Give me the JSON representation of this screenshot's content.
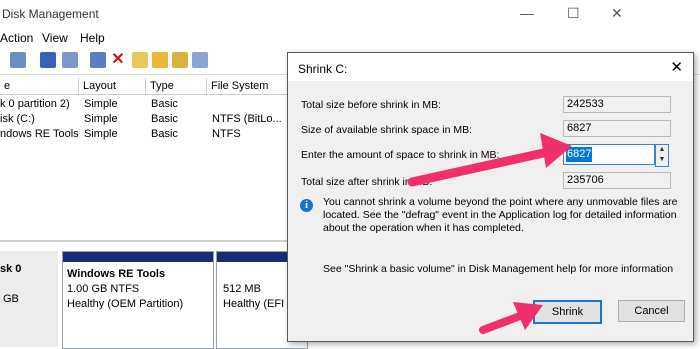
{
  "window": {
    "title": "Disk Management",
    "controls": {
      "minimize": "—",
      "maximize": "☐",
      "close": "✕"
    }
  },
  "menu": {
    "action": "Action",
    "view": "View",
    "help": "Help"
  },
  "volumes": {
    "headers": {
      "volume": "e",
      "layout": "Layout",
      "type": "Type",
      "filesystem": "File System"
    },
    "rows": [
      {
        "name": "k 0 partition 2)",
        "layout": "Simple",
        "type": "Basic",
        "fs": ""
      },
      {
        "name": "isk (C:)",
        "layout": "Simple",
        "type": "Basic",
        "fs": "NTFS (BitLo..."
      },
      {
        "name": "ndows RE Tools",
        "layout": "Simple",
        "type": "Basic",
        "fs": "NTFS"
      }
    ]
  },
  "disk": {
    "label": "sk 0",
    "size": "GB",
    "partitions": [
      {
        "name": "Windows RE Tools",
        "size": "1.00 GB NTFS",
        "status": "Healthy (OEM Partition)"
      },
      {
        "name": "",
        "size": "512 MB",
        "status": "Healthy (EFI S"
      }
    ]
  },
  "dialog": {
    "title": "Shrink C:",
    "close": "✕",
    "total_before_label": "Total size before shrink in MB:",
    "total_before_value": "242533",
    "available_label": "Size of available shrink space in MB:",
    "available_value": "6827",
    "amount_label": "Enter the amount of space to shrink in MB:",
    "amount_value": "6827",
    "after_label": "Total size after shrink in MB:",
    "after_value": "235706",
    "info_icon": "i",
    "info_text": "You cannot shrink a volume beyond the point where any unmovable files are located. See the \"defrag\" event in the Application log for detailed information about the operation when it has completed.",
    "help_text": "See \"Shrink a basic volume\" in Disk Management help for more information",
    "shrink_label": "Shrink",
    "cancel_label": "Cancel"
  },
  "colors": {
    "annotation_arrow": "#f0306a",
    "accent": "#0078d7",
    "partition_header": "#1a2a7a"
  }
}
